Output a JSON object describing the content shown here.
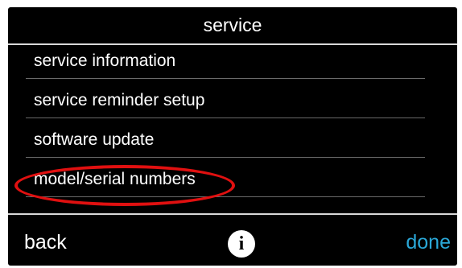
{
  "screen": {
    "title": "service"
  },
  "menu": {
    "items": [
      {
        "label": "service information"
      },
      {
        "label": "service reminder setup"
      },
      {
        "label": "software update"
      },
      {
        "label": "model/serial numbers",
        "highlighted": true
      }
    ]
  },
  "footer": {
    "back_label": "back",
    "info_icon": "info-icon",
    "info_glyph": "i",
    "done_label": "done"
  },
  "colors": {
    "background": "#000000",
    "text": "#ffffff",
    "accent": "#2aa8d8",
    "highlight_ring": "#e01010"
  }
}
